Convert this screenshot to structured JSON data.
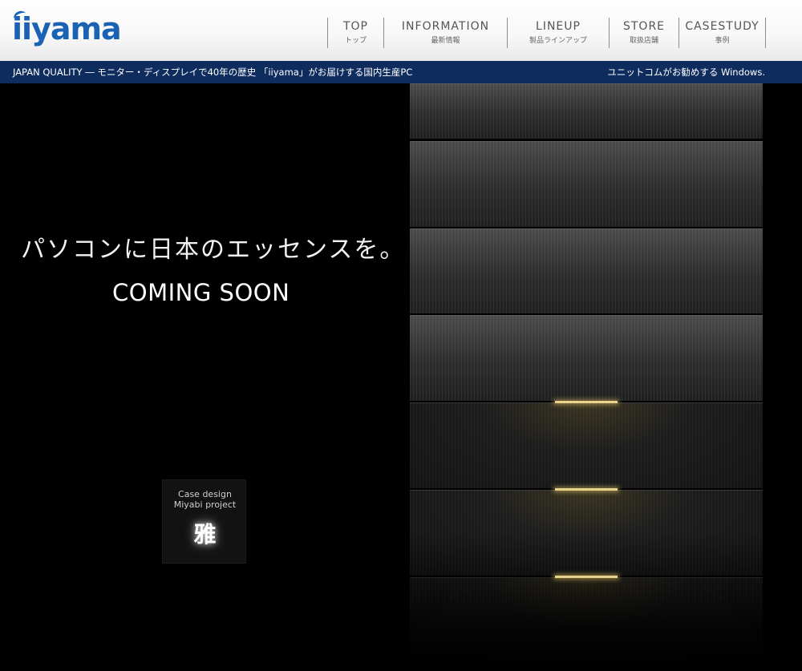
{
  "header": {
    "logo_text": "iiyama",
    "brand_color": "#1a62b3",
    "nav": [
      {
        "en": "TOP",
        "ja": "トップ"
      },
      {
        "en": "INFORMATION",
        "ja": "最新情報"
      },
      {
        "en": "LINEUP",
        "ja": "製品ラインアップ"
      },
      {
        "en": "STORE",
        "ja": "取扱店舗"
      },
      {
        "en": "CASESTUDY",
        "ja": "事例"
      }
    ]
  },
  "strip": {
    "left_text": "JAPAN QUALITY ― モニター・ディスプレイで40年の歴史 「iiyama」がお届けする国内生産PC",
    "right_text": "ユニットコムがお勧めする Windows.",
    "background_color": "#0f2c5e"
  },
  "hero": {
    "tagline": "パソコンに日本のエッセンスを。",
    "coming_soon": "COMING SOON",
    "badge": {
      "line1": "Case design",
      "line2": "Miyabi project",
      "kanji": "雅"
    }
  }
}
